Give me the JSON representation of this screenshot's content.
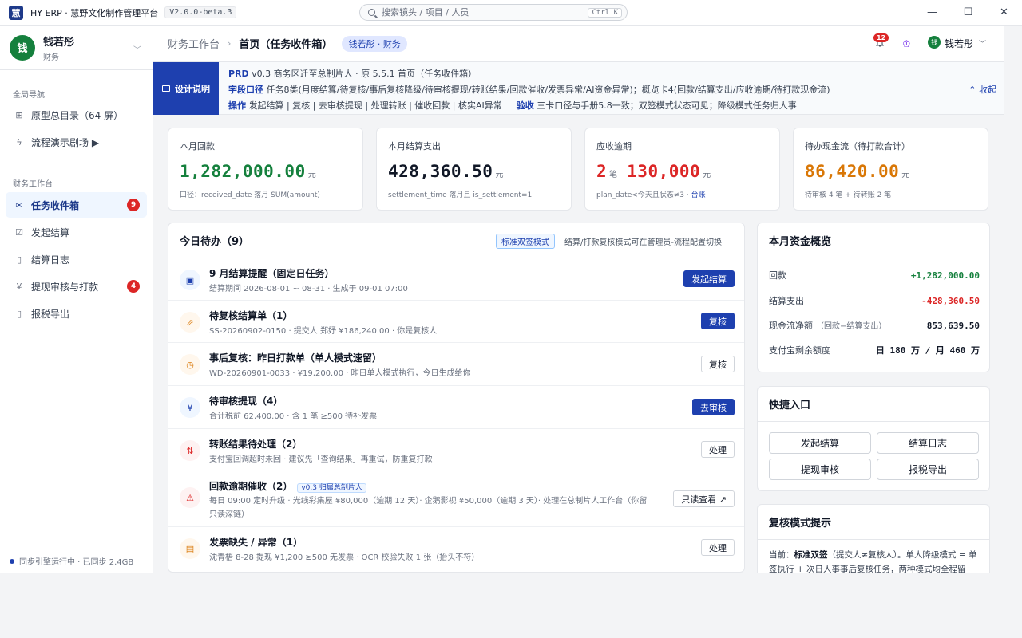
{
  "app": {
    "logo_char": "慧",
    "title": "HY ERP · 慧野文化制作管理平台",
    "version": "V2.0.0-beta.3",
    "search_placeholder": "搜索镜头 / 项目 / 人员",
    "search_shortcut": "Ctrl K"
  },
  "window_controls": {
    "minimize": "—",
    "maximize": "☐",
    "close": "✕"
  },
  "sidebar": {
    "user": {
      "avatar_char": "钱",
      "name": "钱若彤",
      "role": "财务"
    },
    "sections": [
      {
        "title": "全局导航",
        "items": [
          {
            "label": "原型总目录（64 屏）",
            "icon": "grid-icon"
          },
          {
            "label": "流程演示剧场 ▶",
            "icon": "bolt-icon"
          }
        ]
      },
      {
        "title": "财务工作台",
        "items": [
          {
            "label": "任务收件箱",
            "icon": "inbox-icon",
            "badge": "9",
            "active": true
          },
          {
            "label": "发起结算",
            "icon": "check-square-icon"
          },
          {
            "label": "结算日志",
            "icon": "document-icon"
          },
          {
            "label": "提现审核与打款",
            "icon": "yen-icon",
            "badge": "4"
          },
          {
            "label": "报税导出",
            "icon": "file-export-icon"
          }
        ]
      }
    ],
    "sync_status": "同步引擎运行中 · 已同步 2.4GB"
  },
  "header": {
    "breadcrumb_root": "财务工作台",
    "breadcrumb_current": "首页（任务收件箱）",
    "role_pill": "钱若彤 · 财务",
    "notification_count": "12",
    "user_avatar_char": "钱",
    "user_name": "钱若彤"
  },
  "design_note": {
    "tag": "设计说明",
    "line1_key": "PRD",
    "line1_text": " v0.3 商务区迁至总制片人 · 原 5.5.1 首页（任务收件箱）",
    "line2_key": "字段口径",
    "line2_text": " 任务8类(月度结算/待复核/事后复核降级/待审核提现/转账结果/回款催收/发票异常/AI资金异常)；概览卡4(回款/结算支出/应收逾期/待打款现金流)",
    "line3_key": "操作",
    "line3_text": " 发起结算 | 复核 | 去审核提现 | 处理转账 | 催收回款 | 核实AI异常",
    "line3_key2": "验收",
    "line3_text2": " 三卡口径与手册5.8一致；双签模式状态可见；降级模式任务归人事",
    "collapse": "收起"
  },
  "kpis": [
    {
      "label": "本月回款",
      "value": "1,282,000.00",
      "unit": "元",
      "note": "口径：received_date 落月 SUM(amount)",
      "color": "#15803d"
    },
    {
      "label": "本月结算支出",
      "value": "428,360.50",
      "unit": "元",
      "note": "settlement_time 落月且 is_settlement=1",
      "color": "#111827"
    },
    {
      "label": "应收逾期",
      "count": "2",
      "count_unit": "笔",
      "value": "130,000",
      "unit": "元",
      "note": "plan_date<今天且状态≠3 · ",
      "link": "台账",
      "color": "#dc2626"
    },
    {
      "label": "待办现金流（待打款合计）",
      "value": "86,420.00",
      "unit": "元",
      "note": "待审核 4 笔 + 待转账 2 笔",
      "color": "#d97706"
    }
  ],
  "todo": {
    "title": "今日待办（9）",
    "mode_pill": "标准双签模式",
    "mode_hint": "结算/打款复核模式可在管理员-流程配置切换",
    "items": [
      {
        "title": "9 月结算提醒（固定日任务）",
        "sub": "结算期间 2026-08-01 ~ 08-31 · 生成于 09-01 07:00",
        "button": "发起结算",
        "primary": true,
        "icon": "calendar-icon",
        "icon_glyph": "▣",
        "icon_bg": "#eff6ff",
        "icon_color": "#1e40af"
      },
      {
        "title": "待复核结算单（1）",
        "sub": "SS-20260902-0150 · 提交人 郑妤 ¥186,240.00 · 你是复核人",
        "button": "复核",
        "primary": true,
        "icon": "trend-icon",
        "icon_glyph": "⇗",
        "icon_bg": "#fff7ed",
        "icon_color": "#d97706"
      },
      {
        "title": "事后复核：昨日打款单（单人模式速留）",
        "sub": "WD-20260901-0033 · ¥19,200.00 · 昨日单人模式执行，今日生成给你",
        "button": "复核",
        "primary": false,
        "icon": "clock-icon",
        "icon_glyph": "◷",
        "icon_bg": "#fff7ed",
        "icon_color": "#d97706"
      },
      {
        "title": "待审核提现（4）",
        "sub": "合计税前 62,400.00 · 含 1 笔 ≥500 待补发票",
        "button": "去审核",
        "primary": true,
        "icon": "yen-icon",
        "icon_glyph": "¥",
        "icon_bg": "#eff6ff",
        "icon_color": "#1e40af"
      },
      {
        "title": "转账结果待处理（2）",
        "sub": "支付宝回调超时未回 · 建议先「查询结果」再重试，防重复打款",
        "button": "处理",
        "primary": false,
        "icon": "transfer-icon",
        "icon_glyph": "⇅",
        "icon_bg": "#fef2f2",
        "icon_color": "#dc2626"
      },
      {
        "title": "回款逾期催收（2）",
        "tag": "v0.3 归属总制片人",
        "sub": "每日 09:00 定时升级 · 光线彩集屋 ¥80,000（逾期 12 天）· 企鹅影视 ¥50,000（逾期 3 天）· 处理在总制片人工作台（你留",
        "sub2": "只读深链）",
        "button": "只读查看 ↗",
        "primary": false,
        "icon": "warning-icon",
        "icon_glyph": "⚠",
        "icon_bg": "#fef2f2",
        "icon_color": "#dc2626"
      },
      {
        "title": "发票缺失 / 异常（1）",
        "sub": "沈青梧 8-28 提现 ¥1,200 ≥500 无发票 · OCR 校验失败 1 张（抬头不符）",
        "button": "处理",
        "primary": false,
        "icon": "invoice-icon",
        "icon_glyph": "▤",
        "icon_bg": "#fff7ed",
        "icon_color": "#d97706"
      }
    ]
  },
  "fund_overview": {
    "title": "本月资金概览",
    "rows": [
      {
        "label": "回款",
        "value": "+1,282,000.00",
        "color": "#15803d"
      },
      {
        "label": "结算支出",
        "value": "-428,360.50",
        "color": "#dc2626"
      },
      {
        "label": "现金流净额",
        "label_note": "（回款−结算支出）",
        "value": "853,639.50",
        "color": "#111827"
      },
      {
        "label": "支付宝剩余额度",
        "value": "日 180 万 / 月 460 万",
        "color": "#111827"
      }
    ]
  },
  "quick_entry": {
    "title": "快捷入口",
    "buttons": [
      "发起结算",
      "结算日志",
      "提现审核",
      "报税导出"
    ]
  },
  "review_tip": {
    "title": "复核模式提示",
    "prefix": "当前：",
    "mode": "标准双签",
    "text": "（提交人≠复核人）。单人降级模式 = 单签执行 + 次日人事事后复核任务，两种模式均全程留"
  }
}
